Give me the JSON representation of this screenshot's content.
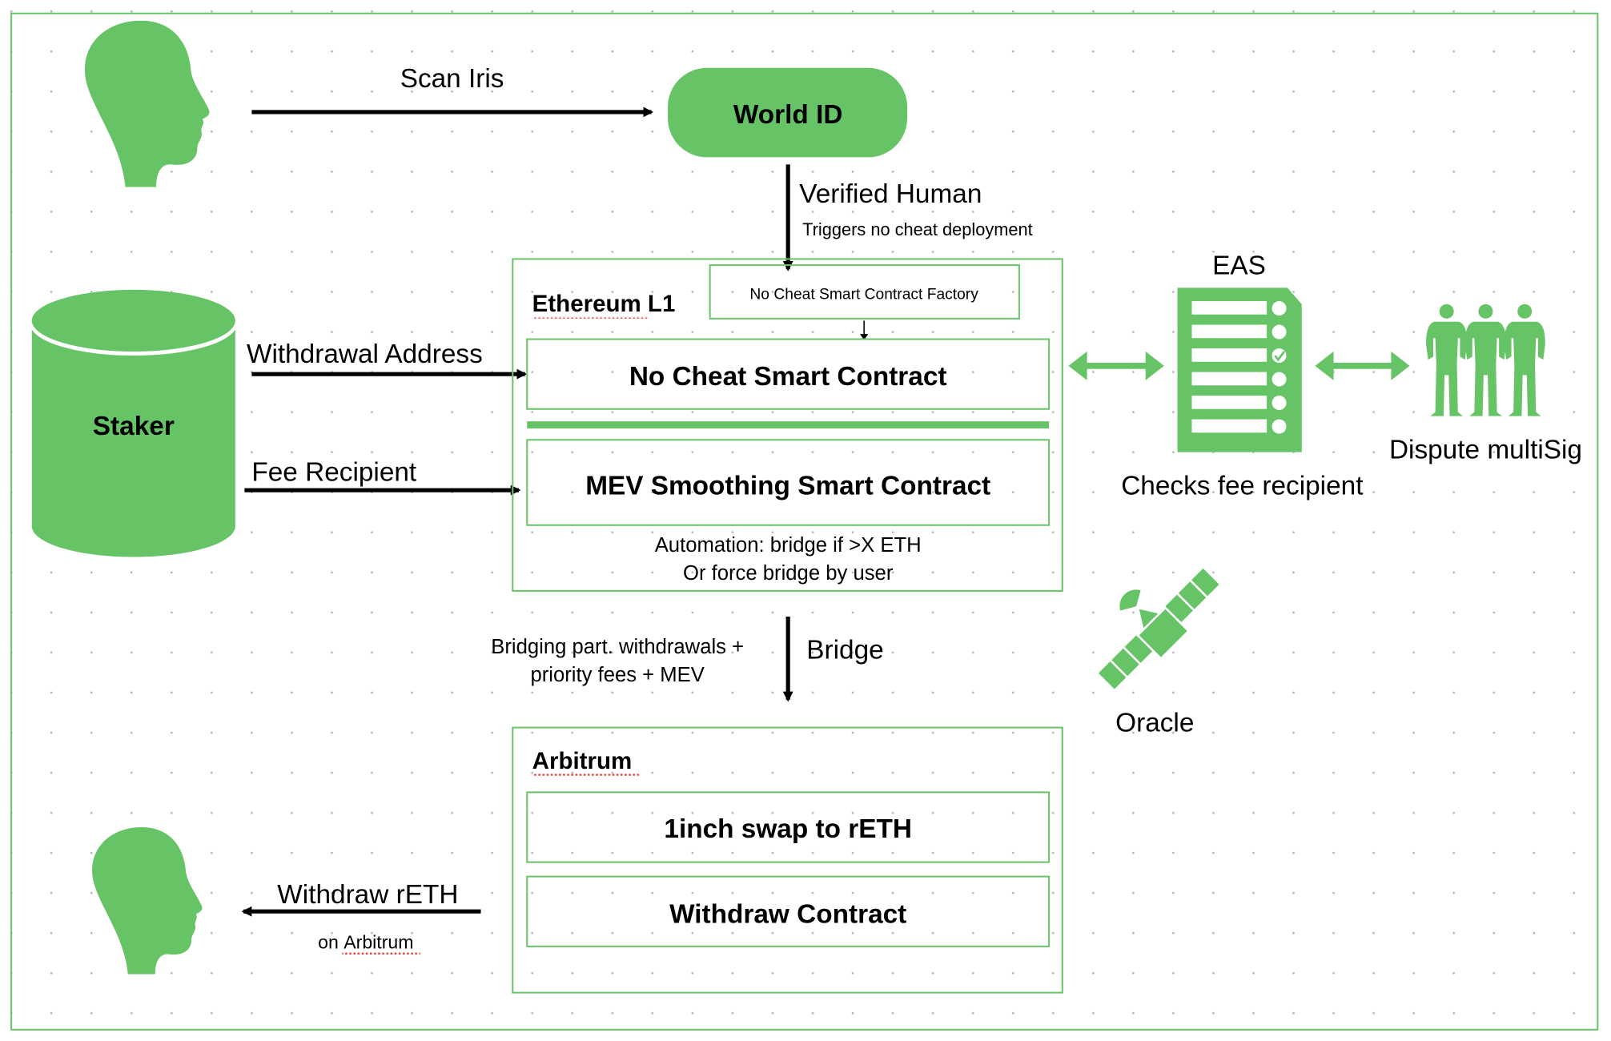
{
  "colors": {
    "accent": "#66c466",
    "frame": "#6cc46c",
    "text": "#000000",
    "arrow": "#000000"
  },
  "top_flow": {
    "icon": "human-head-icon",
    "arrow_label": "Scan Iris",
    "world_id": "World ID",
    "verified_label": "Verified Human",
    "verified_sublabel": "Triggers no cheat deployment"
  },
  "staker": {
    "label": "Staker",
    "withdrawal_label": "Withdrawal Address",
    "fee_label": "Fee Recipient"
  },
  "ethereum": {
    "title": "Ethereum L1",
    "factory": "No Cheat Smart Contract Factory",
    "no_cheat": "No Cheat Smart Contract",
    "mev": "MEV Smoothing Smart Contract",
    "automation_line1": "Automation: bridge if >X ETH",
    "automation_line2": "Or force bridge by user"
  },
  "eas": {
    "label": "EAS",
    "icon": "checklist-document-icon",
    "caption": "Checks fee recipient"
  },
  "dispute": {
    "icon": "group-people-icon",
    "label": "Dispute multiSig"
  },
  "oracle": {
    "icon": "satellite-icon",
    "label": "Oracle"
  },
  "bridge": {
    "label": "Bridge",
    "note_line1": "Bridging part. withdrawals +",
    "note_line2": "priority fees + MEV"
  },
  "arbitrum": {
    "title": "Arbitrum",
    "swap": "1inch swap to rETH",
    "withdraw": "Withdraw Contract"
  },
  "bottom_flow": {
    "icon": "human-head-icon",
    "label": "Withdraw rETH",
    "sublabel_prefix": "on ",
    "sublabel_link": "Arbitrum"
  }
}
